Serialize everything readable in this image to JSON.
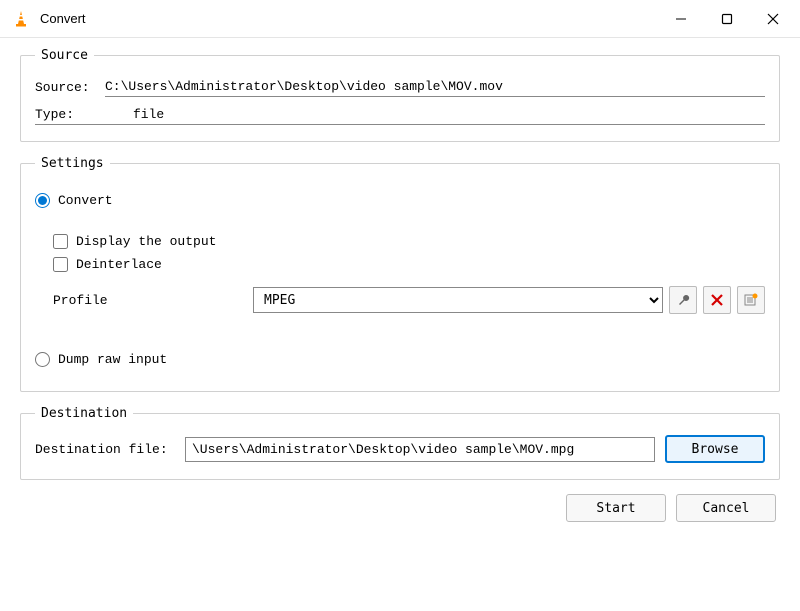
{
  "window": {
    "title": "Convert"
  },
  "source": {
    "legend": "Source",
    "source_label": "Source:",
    "source_value": "C:\\Users\\Administrator\\Desktop\\video sample\\MOV.mov",
    "type_label": "Type:",
    "type_value": "file"
  },
  "settings": {
    "legend": "Settings",
    "convert_label": "Convert",
    "display_output_label": "Display the output",
    "deinterlace_label": "Deinterlace",
    "profile_label": "Profile",
    "profile_value": "MPEG",
    "dump_label": "Dump raw input"
  },
  "destination": {
    "legend": "Destination",
    "file_label": "Destination file:",
    "file_value": "\\Users\\Administrator\\Desktop\\video sample\\MOV.mpg",
    "browse_label": "Browse"
  },
  "footer": {
    "start_label": "Start",
    "cancel_label": "Cancel"
  }
}
